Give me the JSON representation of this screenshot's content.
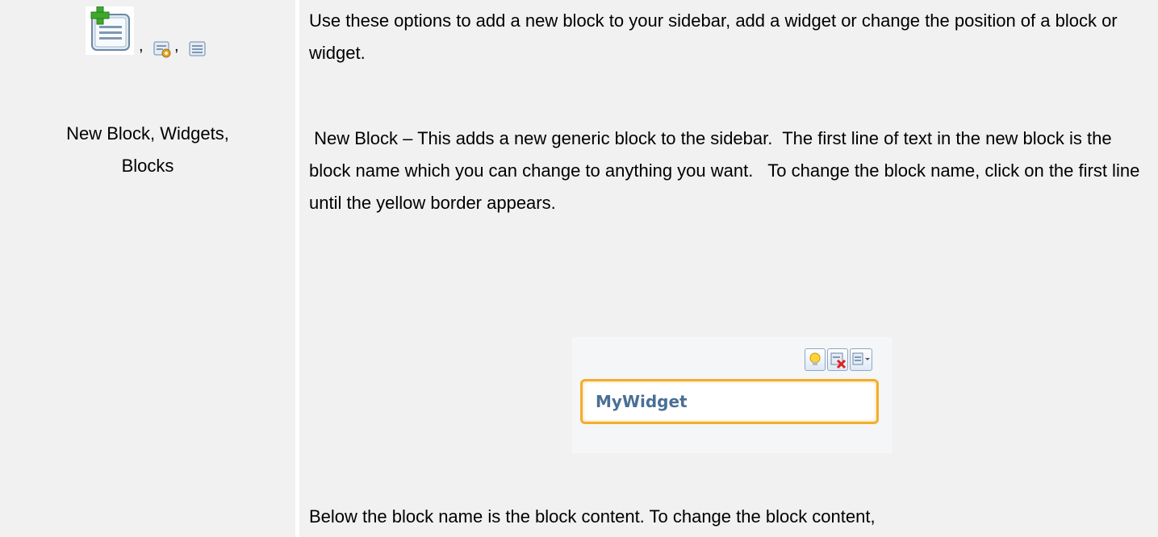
{
  "left": {
    "icons": [
      "new-block-icon",
      "widgets-icon",
      "blocks-icon"
    ],
    "separators": [
      ",",
      ","
    ],
    "caption_line1": "New Block, Widgets,",
    "caption_line2": "Blocks"
  },
  "right": {
    "paragraph1": "Use these options to add a new block to your sidebar, add a widget or change the position of a block or widget.",
    "paragraph2": " New Block – This adds a new generic block to the sidebar.  The first line of text in the new block is the block name which you can change to anything you want.   To change the block name, click on the first line until the yellow border appears.",
    "paragraph3": "Below the block name is the block content.  To change the block content,",
    "widget_example": {
      "name": "MyWidget",
      "tool_icons": [
        "lightbulb-icon",
        "delete-icon",
        "layout-dropdown-icon"
      ],
      "colors": {
        "border": "#f2ae2e",
        "name_text": "#4a6f96"
      }
    }
  }
}
